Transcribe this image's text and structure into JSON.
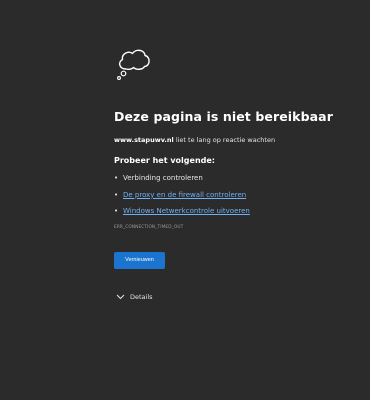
{
  "error": {
    "title": "Deze pagina is niet bereikbaar",
    "host": "www.stapuwv.nl",
    "description_suffix": " liet te lang op reactie wachten",
    "try_heading": "Probeer het volgende:",
    "suggestions": [
      {
        "label": "Verbinding controleren",
        "is_link": false
      },
      {
        "label": "De proxy en de firewall controleren",
        "is_link": true
      },
      {
        "label": "Windows Netwerkcontrole uitvoeren",
        "is_link": true
      }
    ],
    "code": "ERR_CONNECTION_TIMED_OUT",
    "reload_label": "Vernieuwen",
    "details_label": "Details"
  },
  "icons": {
    "main": "thought-cloud-icon",
    "details": "chevron-down-icon",
    "bullet": "•"
  },
  "colors": {
    "background": "#2b2b2b",
    "link": "#6fb0f2",
    "button": "#1b74d0",
    "error_code": "#9a9a9a"
  }
}
